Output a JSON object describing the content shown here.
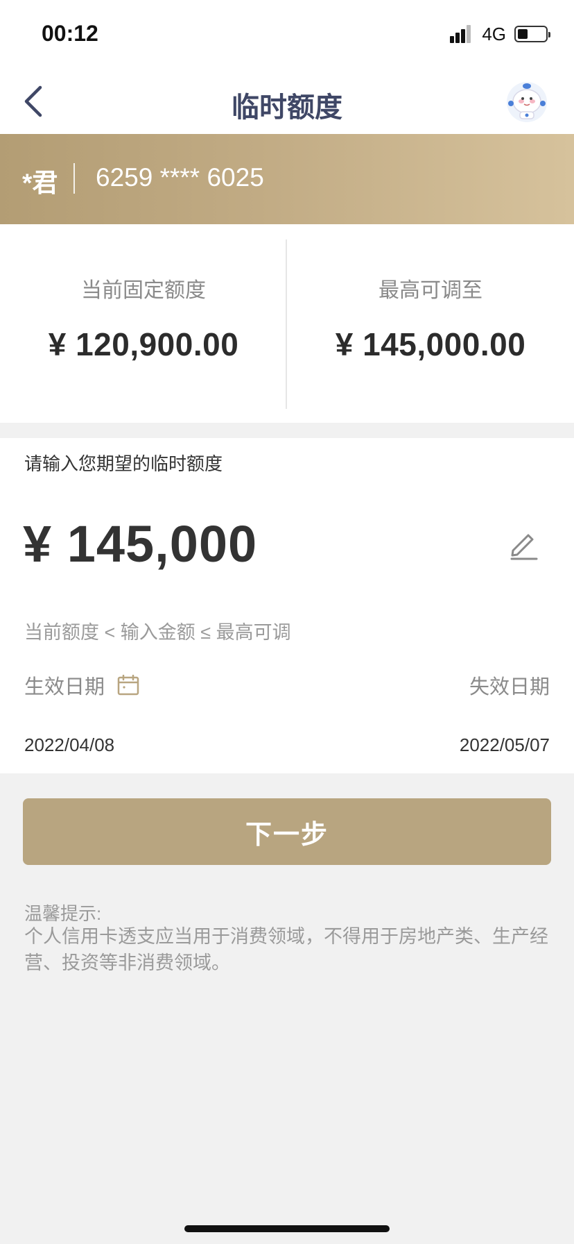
{
  "status_bar": {
    "time": "00:12",
    "network": "4G",
    "battery_level": 0.35
  },
  "nav": {
    "title": "临时额度",
    "back_icon": "chevron-left-icon",
    "mascot_icon": "mascot-avatar-icon"
  },
  "card": {
    "holder": "*君",
    "number": "6259 **** 6025"
  },
  "limits": {
    "current_label": "当前固定额度",
    "current_amount": "¥ 120,900.00",
    "max_label": "最高可调至",
    "max_amount": "¥ 145,000.00"
  },
  "input": {
    "prompt": "请输入您期望的临时额度",
    "amount": "¥ 145,000",
    "range_hint": "当前额度 < 输入金额 ≤ 最高可调",
    "effective_label": "生效日期",
    "expiry_label": "失效日期",
    "effective_date": "2022/04/08",
    "expiry_date": "2022/05/07"
  },
  "actions": {
    "next_label": "下一步"
  },
  "tips": {
    "title": "温馨提示:",
    "body": "个人信用卡透支应当用于消费领域，不得用于房地产类、生产经营、投资等非消费领域。"
  },
  "colors": {
    "accent": "#b8a580",
    "title": "#3f4766",
    "banner_start": "#b39d74",
    "banner_end": "#d6c29c"
  }
}
